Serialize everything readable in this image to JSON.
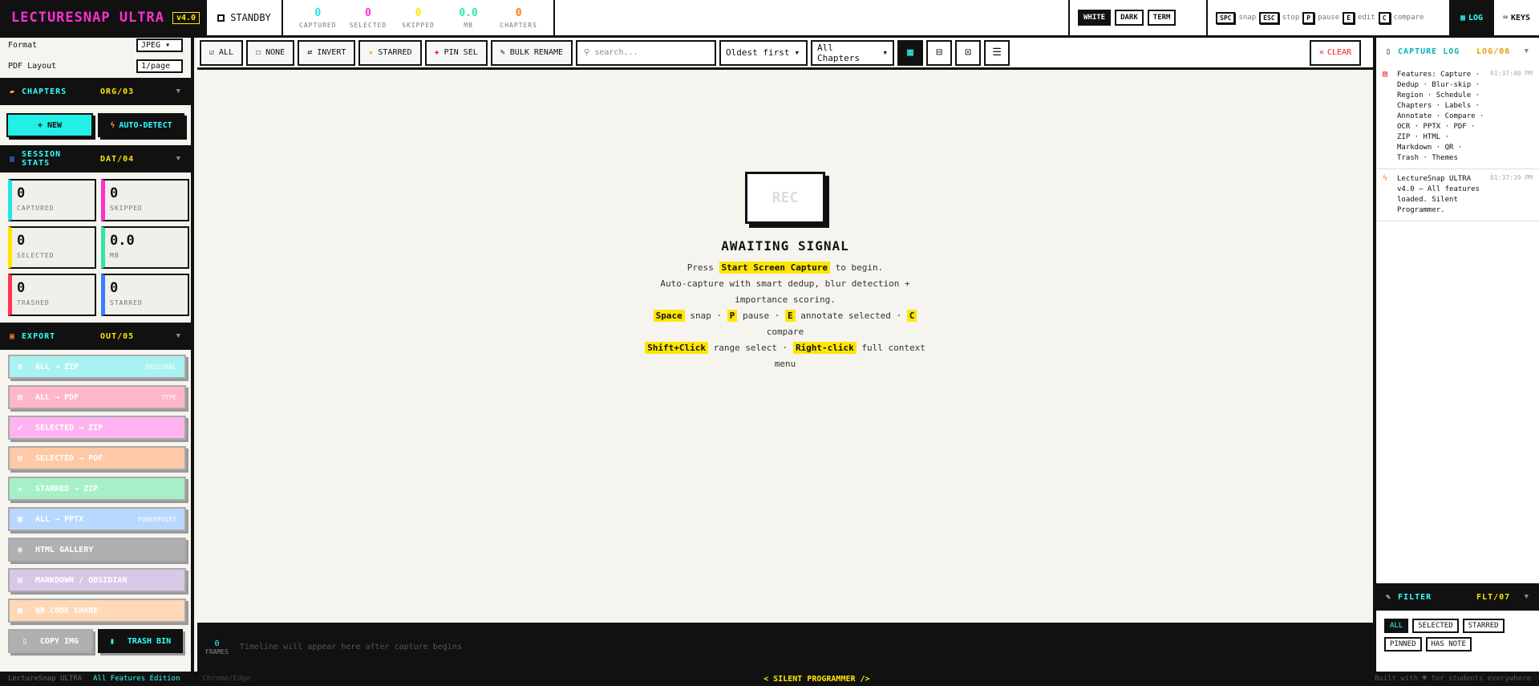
{
  "app": {
    "name": "LECTURESNAP ULTRA",
    "version": "v4.0",
    "status": "STANDBY"
  },
  "stats": [
    {
      "value": "0",
      "label": "CAPTURED",
      "color": "#22e6e6"
    },
    {
      "value": "0",
      "label": "SELECTED",
      "color": "#ff2fd3"
    },
    {
      "value": "0",
      "label": "SKIPPED",
      "color": "#ffe600"
    },
    {
      "value": "0.0",
      "label": "MB",
      "color": "#2ee6a0"
    },
    {
      "value": "0",
      "label": "CHAPTERS",
      "color": "#ff7a1a"
    }
  ],
  "themes": [
    "WHITE",
    "DARK",
    "TERM"
  ],
  "keys": [
    {
      "k": "SPC",
      "d": "snap"
    },
    {
      "k": "ESC",
      "d": "stop"
    },
    {
      "k": "P",
      "d": "pause"
    },
    {
      "k": "E",
      "d": "edit"
    },
    {
      "k": "C",
      "d": "compare"
    }
  ],
  "tabs": {
    "log": "LOG",
    "keys": "KEYS"
  },
  "sidebar": {
    "format_label": "Format",
    "format_value": "JPEG",
    "layout_label": "PDF Layout",
    "layout_value": "1/page",
    "chapters": {
      "title": "CHAPTERS",
      "code": "ORG/03"
    },
    "new_btn": "+ NEW",
    "auto_btn": "AUTO-DETECT",
    "session": {
      "title": "SESSION STATS",
      "code": "DAT/04"
    },
    "cards": [
      {
        "value": "0",
        "label": "CAPTURED",
        "color": "#22e6e6"
      },
      {
        "value": "0",
        "label": "SKIPPED",
        "color": "#ff2fd3"
      },
      {
        "value": "0",
        "label": "SELECTED",
        "color": "#ffe600"
      },
      {
        "value": "0.0",
        "label": "MB",
        "color": "#2ee6a0"
      },
      {
        "value": "0",
        "label": "TRASHED",
        "color": "#ff3355"
      },
      {
        "value": "0",
        "label": "STARRED",
        "color": "#3a7bff"
      }
    ],
    "export": {
      "title": "EXPORT",
      "code": "OUT/05"
    },
    "exports": [
      {
        "label": "ALL → ZIP",
        "tag": "ORIGINAL",
        "bg": "#a8f2f2"
      },
      {
        "label": "ALL → PDF",
        "tag": "TYPE",
        "bg": "#ffb6c8"
      },
      {
        "label": "SELECTED → ZIP",
        "tag": "",
        "bg": "#ffb3f0"
      },
      {
        "label": "SELECTED → PDF",
        "tag": "",
        "bg": "#ffc8a6"
      },
      {
        "label": "STARRED → ZIP",
        "tag": "",
        "bg": "#a6f0c8"
      },
      {
        "label": "ALL → PPTX",
        "tag": "POWERPOINT",
        "bg": "#b8d8ff"
      },
      {
        "label": "HTML GALLERY",
        "tag": "",
        "bg": "#b0b0b0"
      },
      {
        "label": "MARKDOWN / OBSIDIAN",
        "tag": "",
        "bg": "#d8c8e8"
      },
      {
        "label": "QR CODE SHARE",
        "tag": "",
        "bg": "#ffd8b8"
      }
    ],
    "copy_img": "COPY IMG",
    "trash_bin": "TRASH BIN"
  },
  "toolbar": {
    "all": "ALL",
    "none": "NONE",
    "invert": "INVERT",
    "starred": "STARRED",
    "pin": "PIN SEL",
    "bulk": "BULK RENAME",
    "search_placeholder": "search...",
    "sort": "Oldest first",
    "chapters": "All Chapters",
    "clear": "CLEAR"
  },
  "empty": {
    "rec": "REC",
    "title": "AWAITING SIGNAL",
    "press": "Press",
    "start": "Start Screen Capture",
    "to_begin": "to begin.",
    "auto": "Auto-capture with smart dedup, blur detection + importance scoring.",
    "space": "Space",
    "snap": "snap",
    "p": "P",
    "pause": "pause",
    "e": "E",
    "annotate": "annotate selected",
    "c": "C",
    "compare": "compare",
    "shift": "Shift+Click",
    "range": "range select",
    "right": "Right-click",
    "full": "full context menu"
  },
  "timeline": {
    "count": "0",
    "label": "FRAMES",
    "message": "Timeline will appear here after capture begins"
  },
  "log": {
    "title": "CAPTURE LOG",
    "code": "LOG/06",
    "entries": [
      {
        "text": "Features: Capture · Dedup · Blur-skip · Region · Schedule · Chapters · Labels · Annotate · Compare · OCR · PPTX · PDF · ZIP · HTML · Markdown · QR · Trash · Themes",
        "time": "01:37:40 PM"
      },
      {
        "text": "LectureSnap ULTRA v4.0 — All features loaded. Silent Programmer.",
        "time": "01:37:39 PM"
      }
    ]
  },
  "filter": {
    "title": "FILTER",
    "code": "FLT/07",
    "chips": [
      "ALL",
      "SELECTED",
      "STARRED",
      "PINNED",
      "HAS NOTE"
    ]
  },
  "footer": {
    "left": "LectureSnap ULTRA",
    "edition": "All Features Edition",
    "browser": "Chrome/Edge",
    "center": "< SILENT PROGRAMMER />",
    "right": "Built with ♥ for students everywhere"
  }
}
